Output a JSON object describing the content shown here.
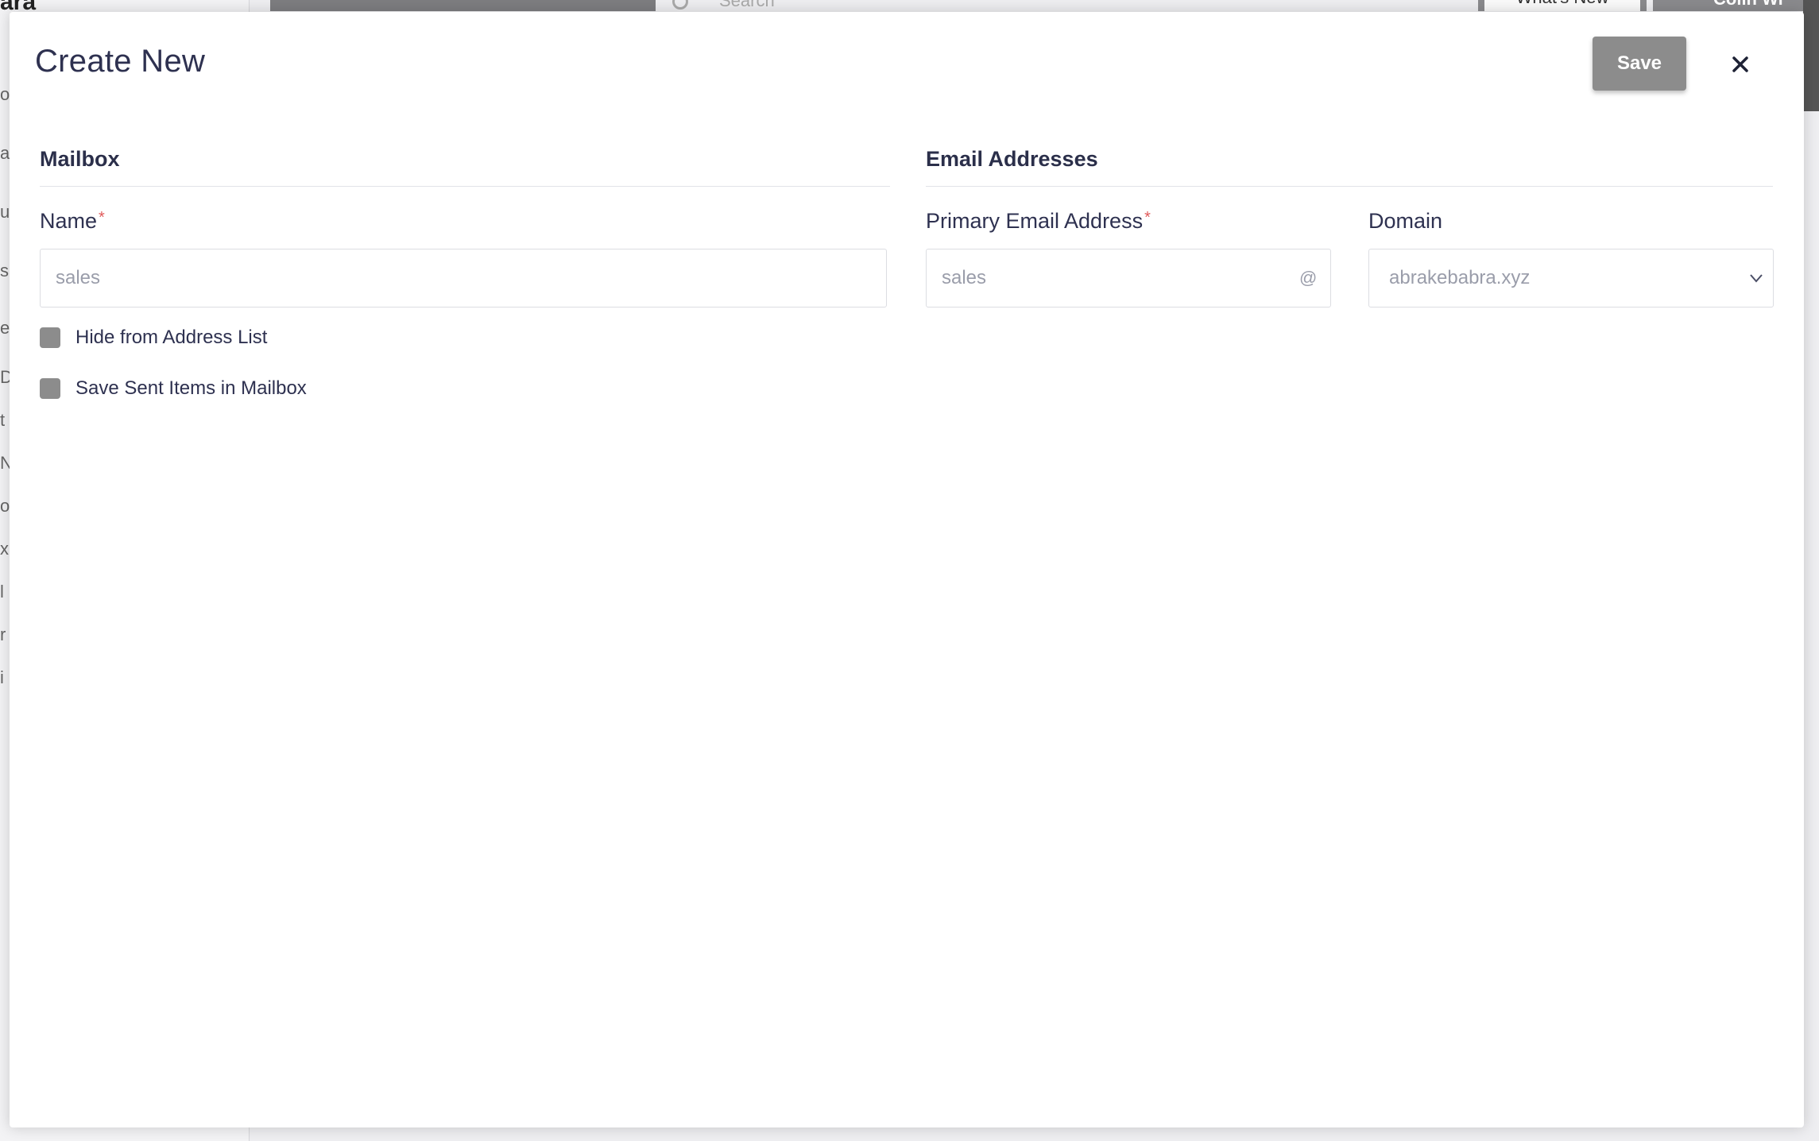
{
  "modal": {
    "title": "Create New",
    "save_label": "Save"
  },
  "mailbox_section": {
    "title": "Mailbox",
    "name_label": "Name",
    "name_required": "*",
    "name_value": "sales",
    "hide_from_address_list": "Hide from Address List",
    "save_sent_items": "Save Sent Items in Mailbox"
  },
  "email_section": {
    "title": "Email Addresses",
    "primary_label": "Primary Email Address",
    "primary_required": "*",
    "primary_value": "sales",
    "at_symbol": "@",
    "domain_label": "Domain",
    "domain_value": "abrakebabra.xyz"
  },
  "background": {
    "search_placeholder": "Search",
    "whats_new": "What's New",
    "user_name": "Colin Wi"
  },
  "icons": {
    "close": "close-icon",
    "chevron": "chevron-down-icon",
    "at": "at-icon"
  },
  "colors": {
    "button_disabled": "#8c8c8c",
    "required": "#e05a5a",
    "text_dark": "#2e3150"
  }
}
